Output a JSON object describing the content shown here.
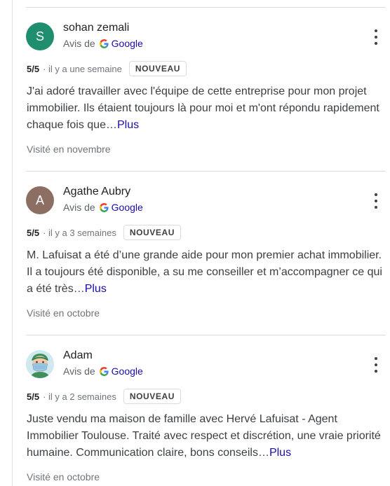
{
  "reviews": [
    {
      "author": "sohan zemali",
      "avatar_letter": "S",
      "avatar_color": "#1e8e6e",
      "source_prefix": "Avis de",
      "source_name": "Google",
      "rating": "5/5",
      "date": "· il y a une semaine",
      "badge": "NOUVEAU",
      "text": "J'ai adoré travailler avec l'équipe de cette entreprise pour mon projet immobilier. Ils étaient toujours là pour moi et m'ont répondu rapidement chaque fois que",
      "ellipsis": "…",
      "more_label": "Plus",
      "visited": "Visité en novembre"
    },
    {
      "author": "Agathe Aubry",
      "avatar_letter": "A",
      "avatar_color": "#8d6e63",
      "source_prefix": "Avis de",
      "source_name": "Google",
      "rating": "5/5",
      "date": "· il y a 3 semaines",
      "badge": "NOUVEAU",
      "text": "M. Lafuisat a été d’une grande aide pour mon premier achat immobilier. Il a toujours été disponible, a su me conseiller et m’accompagner ce qui a été très",
      "ellipsis": "…",
      "more_label": "Plus",
      "visited": "Visité en octobre"
    },
    {
      "author": "Adam",
      "avatar_icon": "masked-person-icon",
      "source_prefix": "Avis de",
      "source_name": "Google",
      "rating": "5/5",
      "date": "· il y a 2 semaines",
      "badge": "NOUVEAU",
      "text": "Juste vendu ma maison de famille avec Hervé Lafuisat - Agent Immobilier Toulouse. Traité avec respect et discrétion, une vraie priorité humaine. Communication claire, bons conseils",
      "ellipsis": "…",
      "more_label": "Plus",
      "visited": "Visité en octobre"
    }
  ],
  "icons": {
    "source": "google-g-icon",
    "menu": "more-vert-icon"
  },
  "colors": {
    "link": "#1a0dab",
    "meta_gray": "#70757a",
    "divider": "#dadce0"
  }
}
